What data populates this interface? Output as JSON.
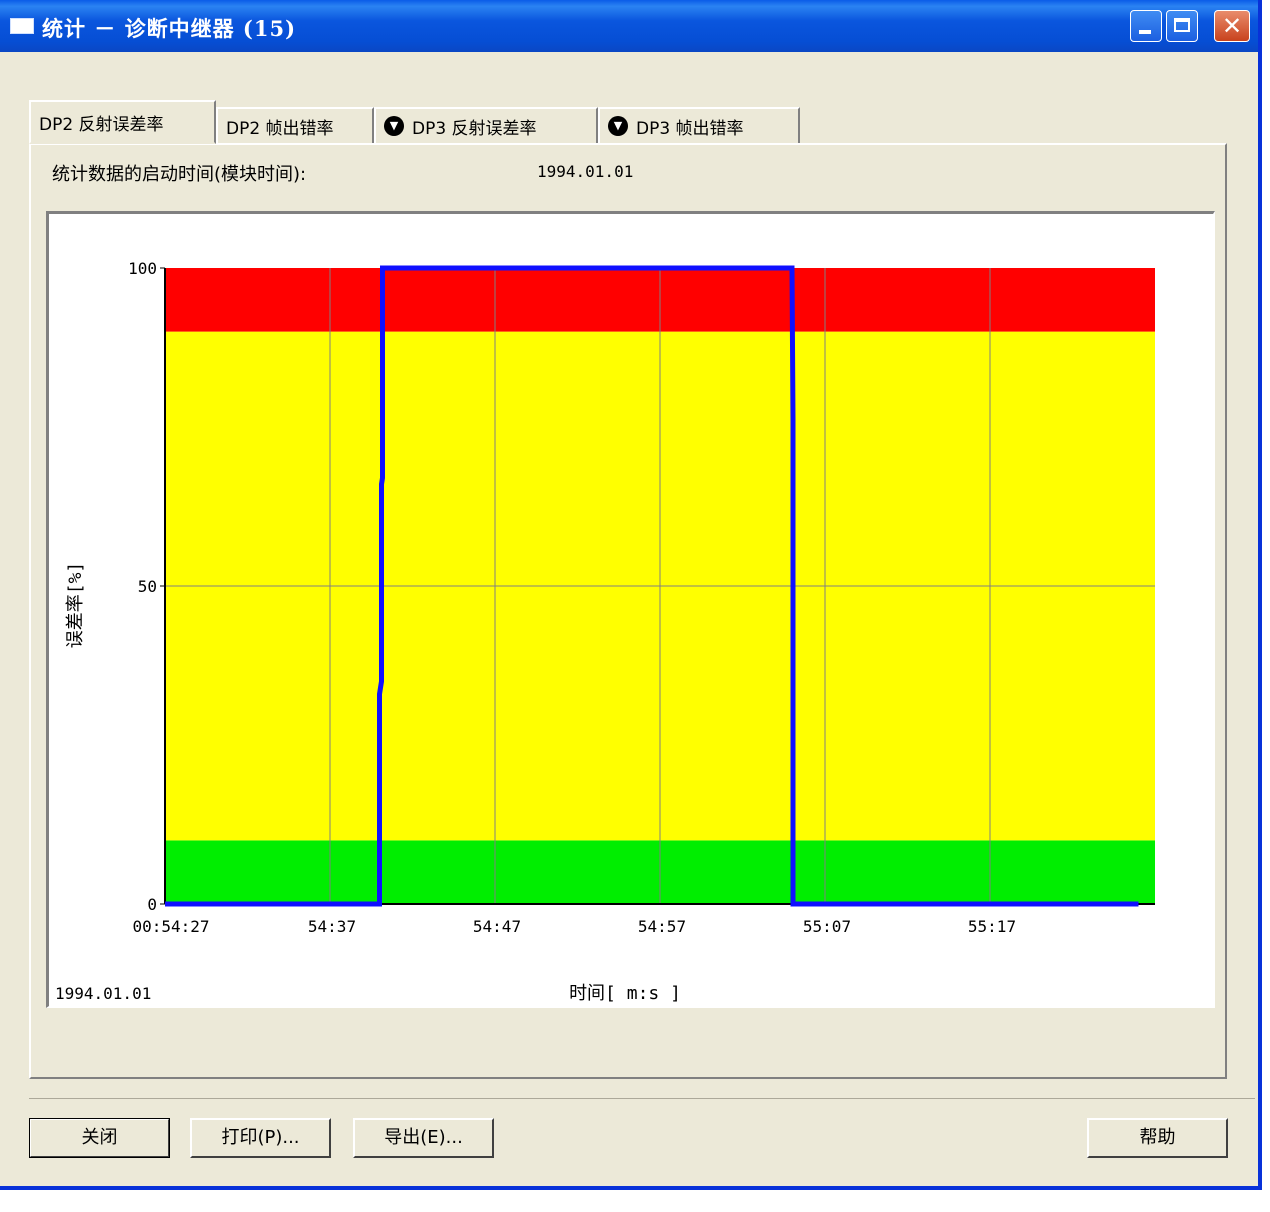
{
  "window": {
    "title": "统计 － 诊断中继器 (15)"
  },
  "tabs": [
    {
      "label": "DP2 反射误差率",
      "active": true,
      "icon": null
    },
    {
      "label": "DP2 帧出错率",
      "active": false,
      "icon": null
    },
    {
      "label": "DP3 反射误差率",
      "active": false,
      "icon": "down-arrow-circle-icon"
    },
    {
      "label": "DP3 帧出错率",
      "active": false,
      "icon": "down-arrow-circle-icon"
    }
  ],
  "info": {
    "start_label": "统计数据的启动时间(模块时间):",
    "start_value": "1994.01.01"
  },
  "chart_data": {
    "type": "line",
    "title": "",
    "xlabel": "时间[ m:s ]",
    "ylabel": "误差率[%]",
    "date_label": "1994.01.01",
    "ylim": [
      0,
      100
    ],
    "xlim": [
      "00:54:27",
      "00:55:27"
    ],
    "x_tick_labels": [
      "00:54:27",
      "54:37",
      "54:47",
      "54:57",
      "55:07",
      "55:17"
    ],
    "y_tick_labels": [
      "0",
      "50",
      "100"
    ],
    "y_ticks": [
      0,
      50,
      100
    ],
    "grid": true,
    "bands": [
      {
        "from": 0,
        "to": 10,
        "color": "#00ee00"
      },
      {
        "from": 10,
        "to": 90,
        "color": "#ffff00"
      },
      {
        "from": 90,
        "to": 100,
        "color": "#ff0000"
      }
    ],
    "series": [
      {
        "color": "#1010ff",
        "x": [
          "00:54:27",
          "00:54:40",
          "00:54:40",
          "00:54:40",
          "00:54:40",
          "00:54:40",
          "00:54:40",
          "00:55:05",
          "00:55:05",
          "00:55:05",
          "00:55:26"
        ],
        "y": [
          0,
          0,
          33,
          35,
          66,
          67,
          100,
          100,
          76,
          0,
          0
        ]
      }
    ]
  },
  "buttons": {
    "close": "关闭",
    "print": "打印(P)...",
    "export": "导出(E)...",
    "help": "帮助"
  },
  "colors": {
    "titlebar": "#0a56de",
    "dialog_bg": "#ece9d8"
  }
}
